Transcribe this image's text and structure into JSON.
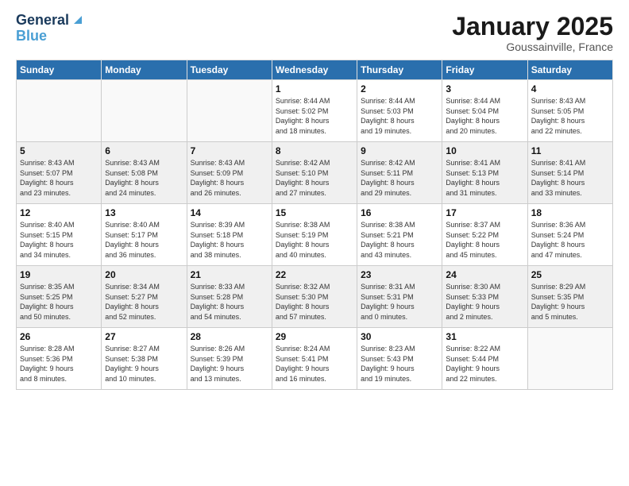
{
  "logo": {
    "line1": "General",
    "line2": "Blue"
  },
  "title": "January 2025",
  "location": "Goussainville, France",
  "days_header": [
    "Sunday",
    "Monday",
    "Tuesday",
    "Wednesday",
    "Thursday",
    "Friday",
    "Saturday"
  ],
  "weeks": [
    {
      "shaded": false,
      "days": [
        {
          "num": "",
          "info": ""
        },
        {
          "num": "",
          "info": ""
        },
        {
          "num": "",
          "info": ""
        },
        {
          "num": "1",
          "info": "Sunrise: 8:44 AM\nSunset: 5:02 PM\nDaylight: 8 hours\nand 18 minutes."
        },
        {
          "num": "2",
          "info": "Sunrise: 8:44 AM\nSunset: 5:03 PM\nDaylight: 8 hours\nand 19 minutes."
        },
        {
          "num": "3",
          "info": "Sunrise: 8:44 AM\nSunset: 5:04 PM\nDaylight: 8 hours\nand 20 minutes."
        },
        {
          "num": "4",
          "info": "Sunrise: 8:43 AM\nSunset: 5:05 PM\nDaylight: 8 hours\nand 22 minutes."
        }
      ]
    },
    {
      "shaded": true,
      "days": [
        {
          "num": "5",
          "info": "Sunrise: 8:43 AM\nSunset: 5:07 PM\nDaylight: 8 hours\nand 23 minutes."
        },
        {
          "num": "6",
          "info": "Sunrise: 8:43 AM\nSunset: 5:08 PM\nDaylight: 8 hours\nand 24 minutes."
        },
        {
          "num": "7",
          "info": "Sunrise: 8:43 AM\nSunset: 5:09 PM\nDaylight: 8 hours\nand 26 minutes."
        },
        {
          "num": "8",
          "info": "Sunrise: 8:42 AM\nSunset: 5:10 PM\nDaylight: 8 hours\nand 27 minutes."
        },
        {
          "num": "9",
          "info": "Sunrise: 8:42 AM\nSunset: 5:11 PM\nDaylight: 8 hours\nand 29 minutes."
        },
        {
          "num": "10",
          "info": "Sunrise: 8:41 AM\nSunset: 5:13 PM\nDaylight: 8 hours\nand 31 minutes."
        },
        {
          "num": "11",
          "info": "Sunrise: 8:41 AM\nSunset: 5:14 PM\nDaylight: 8 hours\nand 33 minutes."
        }
      ]
    },
    {
      "shaded": false,
      "days": [
        {
          "num": "12",
          "info": "Sunrise: 8:40 AM\nSunset: 5:15 PM\nDaylight: 8 hours\nand 34 minutes."
        },
        {
          "num": "13",
          "info": "Sunrise: 8:40 AM\nSunset: 5:17 PM\nDaylight: 8 hours\nand 36 minutes."
        },
        {
          "num": "14",
          "info": "Sunrise: 8:39 AM\nSunset: 5:18 PM\nDaylight: 8 hours\nand 38 minutes."
        },
        {
          "num": "15",
          "info": "Sunrise: 8:38 AM\nSunset: 5:19 PM\nDaylight: 8 hours\nand 40 minutes."
        },
        {
          "num": "16",
          "info": "Sunrise: 8:38 AM\nSunset: 5:21 PM\nDaylight: 8 hours\nand 43 minutes."
        },
        {
          "num": "17",
          "info": "Sunrise: 8:37 AM\nSunset: 5:22 PM\nDaylight: 8 hours\nand 45 minutes."
        },
        {
          "num": "18",
          "info": "Sunrise: 8:36 AM\nSunset: 5:24 PM\nDaylight: 8 hours\nand 47 minutes."
        }
      ]
    },
    {
      "shaded": true,
      "days": [
        {
          "num": "19",
          "info": "Sunrise: 8:35 AM\nSunset: 5:25 PM\nDaylight: 8 hours\nand 50 minutes."
        },
        {
          "num": "20",
          "info": "Sunrise: 8:34 AM\nSunset: 5:27 PM\nDaylight: 8 hours\nand 52 minutes."
        },
        {
          "num": "21",
          "info": "Sunrise: 8:33 AM\nSunset: 5:28 PM\nDaylight: 8 hours\nand 54 minutes."
        },
        {
          "num": "22",
          "info": "Sunrise: 8:32 AM\nSunset: 5:30 PM\nDaylight: 8 hours\nand 57 minutes."
        },
        {
          "num": "23",
          "info": "Sunrise: 8:31 AM\nSunset: 5:31 PM\nDaylight: 9 hours\nand 0 minutes."
        },
        {
          "num": "24",
          "info": "Sunrise: 8:30 AM\nSunset: 5:33 PM\nDaylight: 9 hours\nand 2 minutes."
        },
        {
          "num": "25",
          "info": "Sunrise: 8:29 AM\nSunset: 5:35 PM\nDaylight: 9 hours\nand 5 minutes."
        }
      ]
    },
    {
      "shaded": false,
      "days": [
        {
          "num": "26",
          "info": "Sunrise: 8:28 AM\nSunset: 5:36 PM\nDaylight: 9 hours\nand 8 minutes."
        },
        {
          "num": "27",
          "info": "Sunrise: 8:27 AM\nSunset: 5:38 PM\nDaylight: 9 hours\nand 10 minutes."
        },
        {
          "num": "28",
          "info": "Sunrise: 8:26 AM\nSunset: 5:39 PM\nDaylight: 9 hours\nand 13 minutes."
        },
        {
          "num": "29",
          "info": "Sunrise: 8:24 AM\nSunset: 5:41 PM\nDaylight: 9 hours\nand 16 minutes."
        },
        {
          "num": "30",
          "info": "Sunrise: 8:23 AM\nSunset: 5:43 PM\nDaylight: 9 hours\nand 19 minutes."
        },
        {
          "num": "31",
          "info": "Sunrise: 8:22 AM\nSunset: 5:44 PM\nDaylight: 9 hours\nand 22 minutes."
        },
        {
          "num": "",
          "info": ""
        }
      ]
    }
  ]
}
